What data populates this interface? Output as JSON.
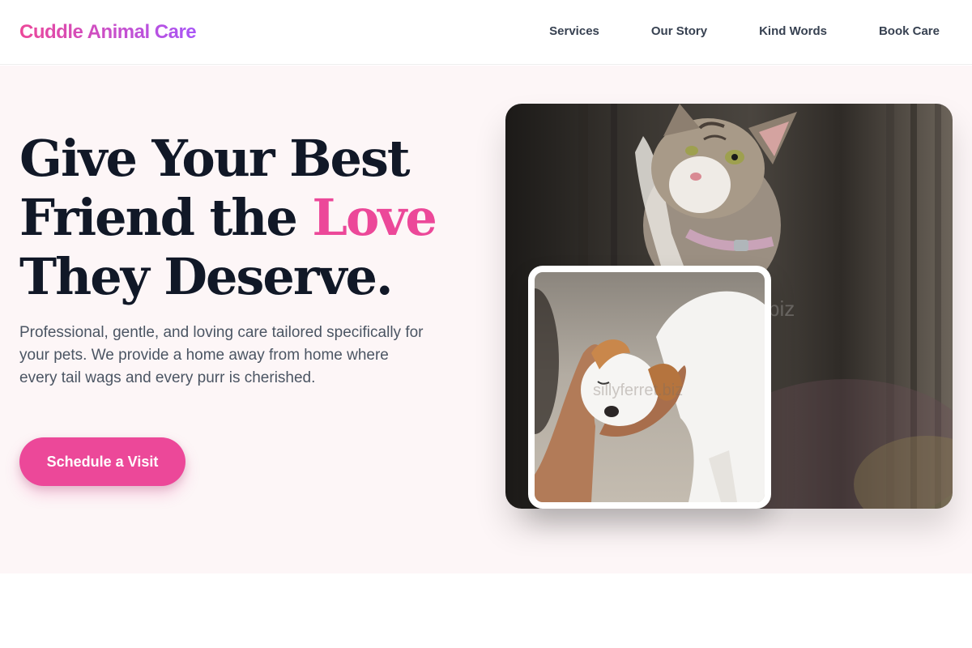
{
  "brand": {
    "name": "Cuddle Animal Care"
  },
  "nav": {
    "items": [
      {
        "label": "Services"
      },
      {
        "label": "Our Story"
      },
      {
        "label": "Kind Words"
      },
      {
        "label": "Book Care"
      }
    ]
  },
  "hero": {
    "headline_line1": "Give Your Best",
    "headline_line2_pre": "Friend the ",
    "headline_accent": "Love",
    "headline_line3": "They Deserve.",
    "description": "Professional, gentle, and loving care tailored specifically for your pets. We provide a home away from home where every tail wags and every purr is cherished.",
    "cta_label": "Schedule a Visit",
    "main_image_watermark": "biz",
    "inset_image_watermark": "sillyferret.biz"
  },
  "colors": {
    "brand_pink": "#ec4899",
    "brand_purple": "#a855f7",
    "hero_background": "#fdf6f7",
    "heading": "#111827",
    "body_text": "#4b5563"
  }
}
